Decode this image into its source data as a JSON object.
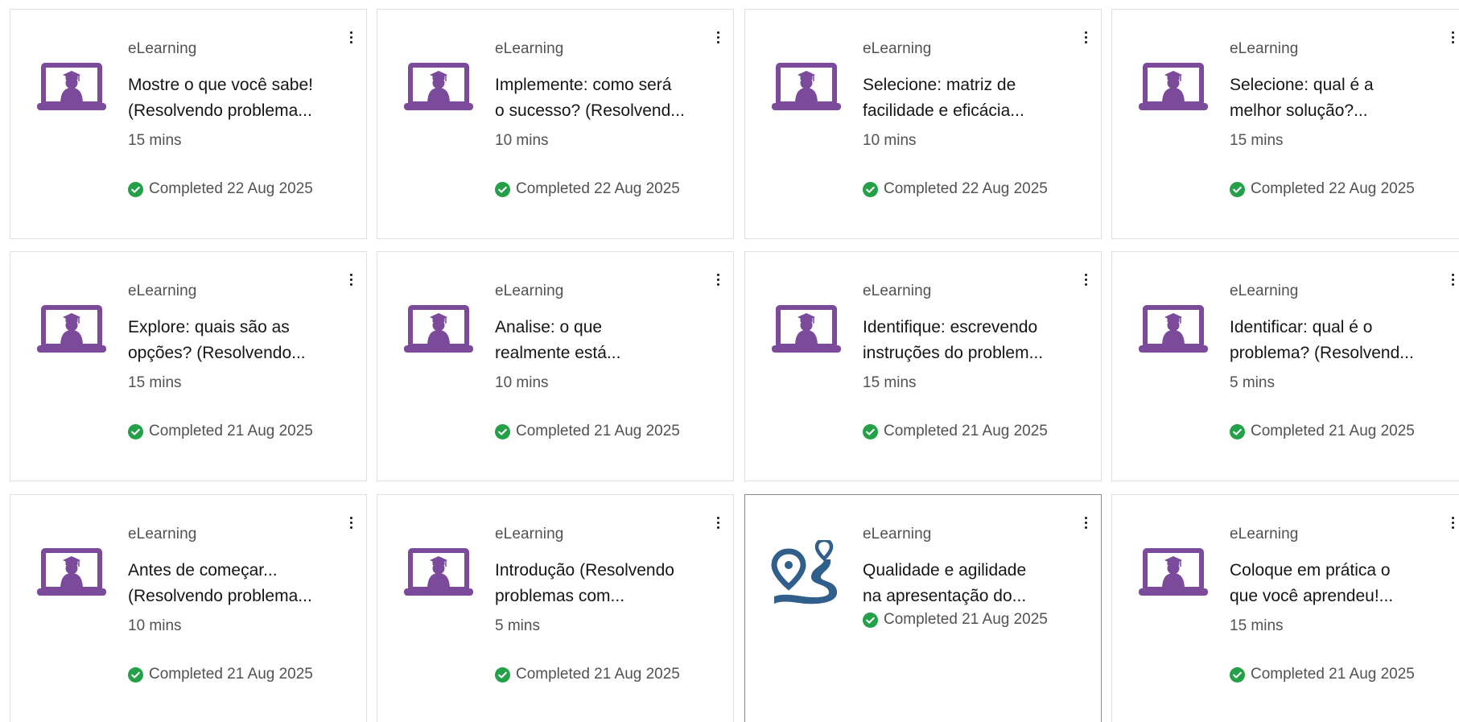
{
  "colors": {
    "icon_purple": "#7b4a9b",
    "map_blue": "#2f5f8a",
    "check_green": "#24a148"
  },
  "cards": [
    {
      "type": "eLearning",
      "title": "Mostre o que você sabe!\n(Resolvendo problema...",
      "duration": "15 mins",
      "status": "Completed 22 Aug 2025",
      "icon": "elearning-laptop-icon"
    },
    {
      "type": "eLearning",
      "title": "Implemente: como será\no sucesso? (Resolvend...",
      "duration": "10 mins",
      "status": "Completed 22 Aug 2025",
      "icon": "elearning-laptop-icon"
    },
    {
      "type": "eLearning",
      "title": "Selecione: matriz de\nfacilidade e eficácia...",
      "duration": "10 mins",
      "status": "Completed 22 Aug 2025",
      "icon": "elearning-laptop-icon"
    },
    {
      "type": "eLearning",
      "title": "Selecione: qual é a\nmelhor solução?...",
      "duration": "15 mins",
      "status": "Completed 22 Aug 2025",
      "icon": "elearning-laptop-icon"
    },
    {
      "type": "eLearning",
      "title": "Explore: quais são as\nopções? (Resolvendo...",
      "duration": "15 mins",
      "status": "Completed 21 Aug 2025",
      "icon": "elearning-laptop-icon"
    },
    {
      "type": "eLearning",
      "title": "Analise: o que\nrealmente está...",
      "duration": "10 mins",
      "status": "Completed 21 Aug 2025",
      "icon": "elearning-laptop-icon"
    },
    {
      "type": "eLearning",
      "title": "Identifique: escrevendo\ninstruções do problem...",
      "duration": "15 mins",
      "status": "Completed 21 Aug 2025",
      "icon": "elearning-laptop-icon"
    },
    {
      "type": "eLearning",
      "title": "Identificar: qual é o\nproblema? (Resolvend...",
      "duration": "5 mins",
      "status": "Completed 21 Aug 2025",
      "icon": "elearning-laptop-icon"
    },
    {
      "type": "eLearning",
      "title": "Antes de começar...\n(Resolvendo problema...",
      "duration": "10 mins",
      "status": "Completed 21 Aug 2025",
      "icon": "elearning-laptop-icon"
    },
    {
      "type": "eLearning",
      "title": "Introdução (Resolvendo\nproblemas com...",
      "duration": "5 mins",
      "status": "Completed 21 Aug 2025",
      "icon": "elearning-laptop-icon"
    },
    {
      "type": "eLearning",
      "title": "Qualidade e agilidade\nna apresentação do...",
      "duration": "",
      "status": "Completed 21 Aug 2025",
      "icon": "map-route-icon"
    },
    {
      "type": "eLearning",
      "title": "Coloque em prática o\nque você aprendeu!...",
      "duration": "15 mins",
      "status": "Completed 21 Aug 2025",
      "icon": "elearning-laptop-icon"
    }
  ]
}
